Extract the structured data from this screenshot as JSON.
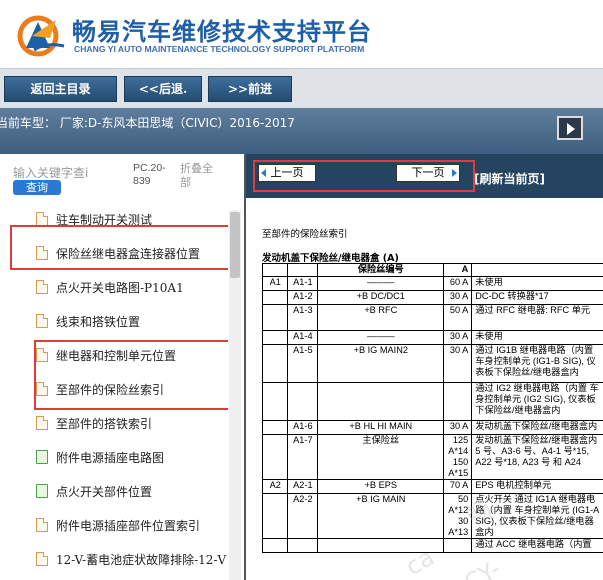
{
  "header": {
    "title": "畅易汽车维修技术支持平台",
    "subtitle": "CHANG YI AUTO MAINTENANCE TECHNOLOGY SUPPORT PLATFORM"
  },
  "nav": {
    "home": "返回主目录",
    "back": "<<后退.",
    "forward": ">>前进"
  },
  "model": {
    "text": "当前车型： 厂家:D-东风本田思域（CIVIC）2016-2017"
  },
  "sidebar": {
    "search_placeholder": "输入关键字查i",
    "query_label": "查询",
    "pc_label": "PC.20-839",
    "collapse_label": "折叠全部",
    "items": [
      {
        "label": "驻车制动开关测试",
        "icon": "document-icon"
      },
      {
        "label": "保险丝继电器盒连接器位置",
        "icon": "document-icon"
      },
      {
        "label": "点火开关电路图-P10A1",
        "icon": "document-icon"
      },
      {
        "label": "线束和搭铁位置",
        "icon": "document-icon"
      },
      {
        "label": "继电器和控制单元位置",
        "icon": "document-icon"
      },
      {
        "label": "至部件的保险丝索引",
        "icon": "document-icon"
      },
      {
        "label": "至部件的搭铁索引",
        "icon": "document-icon"
      },
      {
        "label": "附件电源插座电路图",
        "icon": "folder-icon"
      },
      {
        "label": "点火开关部件位置",
        "icon": "folder-icon"
      },
      {
        "label": "附件电源插座部件位置索引",
        "icon": "document-icon"
      },
      {
        "label": "12-V-蓄电池症状故障排除-12-V",
        "icon": "document-icon"
      }
    ]
  },
  "pager": {
    "prev": "上一页",
    "next": "下一页",
    "refresh": "[刷新当前页]"
  },
  "document": {
    "title": "至部件的保险丝索引",
    "subtitle": "发动机盖下保险丝/继电器盒 (A)",
    "headers": [
      "",
      "",
      "保险丝编号",
      "A",
      ""
    ],
    "rows": [
      [
        "A1",
        "A1-1",
        "———",
        "60 A",
        "未使用"
      ],
      [
        "",
        "A1-2",
        "+B DC/DC1",
        "30 A",
        "DC-DC 转换器*17"
      ],
      [
        "",
        "A1-3",
        "+B RFC",
        "50 A",
        "通过 RFC 继电器: RFC 单元"
      ],
      [
        "",
        "A1-4",
        "———",
        "30 A",
        "未使用"
      ],
      [
        "",
        "A1-5",
        "+B IG MAIN2",
        "30 A",
        "通过 IG1B 继电器电路（内置 车身控制单元 (IG1-B SIG), 仪表板下保险丝/继电器盒内"
      ],
      [
        "",
        "",
        "",
        "",
        "通过 IG2 继电器电路（内置 车身控制单元 (IG2 SIG), 仪表板下保险丝/继电器盒内"
      ],
      [
        "",
        "A1-6",
        "+B HL HI MAIN",
        "30 A",
        "发动机盖下保险丝/继电器盒内"
      ],
      [
        "",
        "A1-7",
        "主保险丝",
        "125 A*14 150 A*15",
        "发动机盖下保险丝/继电器盒内 5 号、A3-6 号、A4-1 号*15, A22 号*18, A23 号 和 A24"
      ],
      [
        "A2",
        "A2-1",
        "+B EPS",
        "70 A",
        "EPS 电机控制单元"
      ],
      [
        "",
        "A2-2",
        "+B IG MAIN",
        "50 A*12 30 A*13",
        "点火开关 通过 IG1A 继电器电路（内置 车身控制单元 (IG1-A SIG), 仪表板下保险丝/继电器盒内"
      ],
      [
        "",
        "",
        "",
        "",
        "通过 ACC 继电器电路（内置"
      ]
    ]
  },
  "watermark": {
    "text1": "畅",
    "text2": "ca",
    "text3": "CY-"
  },
  "colors": {
    "brand_blue": "#1f5fa8",
    "highlight_red": "#e23b3b",
    "nav_button": "#2f5c86",
    "pager_bg": "#24445f"
  }
}
